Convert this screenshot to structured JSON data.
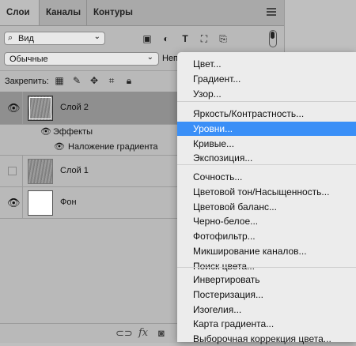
{
  "tabs": [
    "Слои",
    "Каналы",
    "Контуры"
  ],
  "filter": {
    "kind_label": "Вид",
    "kind_icon": "search-icon",
    "chevron": "⌄"
  },
  "blend_mode": {
    "value": "Обычные",
    "chevron": "⌄",
    "opacity_label": "Неп"
  },
  "lock": {
    "label": "Закрепить:"
  },
  "layers": [
    {
      "name": "Слой 2",
      "visible": true,
      "selected": true
    },
    {
      "name": "Слой 1",
      "visible": false,
      "selected": false
    },
    {
      "name": "Фон",
      "visible": true,
      "selected": false
    }
  ],
  "effects": {
    "label": "Эффекты",
    "items": [
      "Наложение градиента"
    ]
  },
  "bottom_icons": [
    "link-icon",
    "fx-icon",
    "mask-icon"
  ],
  "bottom_fx": "fx",
  "menu": {
    "groups": [
      [
        "Цвет...",
        "Градиент...",
        "Узор..."
      ],
      [
        "Яркость/Контрастность...",
        "Уровни...",
        "Кривые...",
        "Экспозиция..."
      ],
      [
        "Сочность...",
        "Цветовой тон/Насыщенность...",
        "Цветовой баланс...",
        "Черно-белое...",
        "Фотофильтр...",
        "Микширование каналов...",
        "Поиск цвета..."
      ],
      [
        "Инвертировать",
        "Постеризация...",
        "Изогелия...",
        "Карта градиента...",
        "Выборочная коррекция цвета..."
      ]
    ],
    "highlighted": "Уровни...",
    "highlight_color": "#3a8ff7"
  }
}
